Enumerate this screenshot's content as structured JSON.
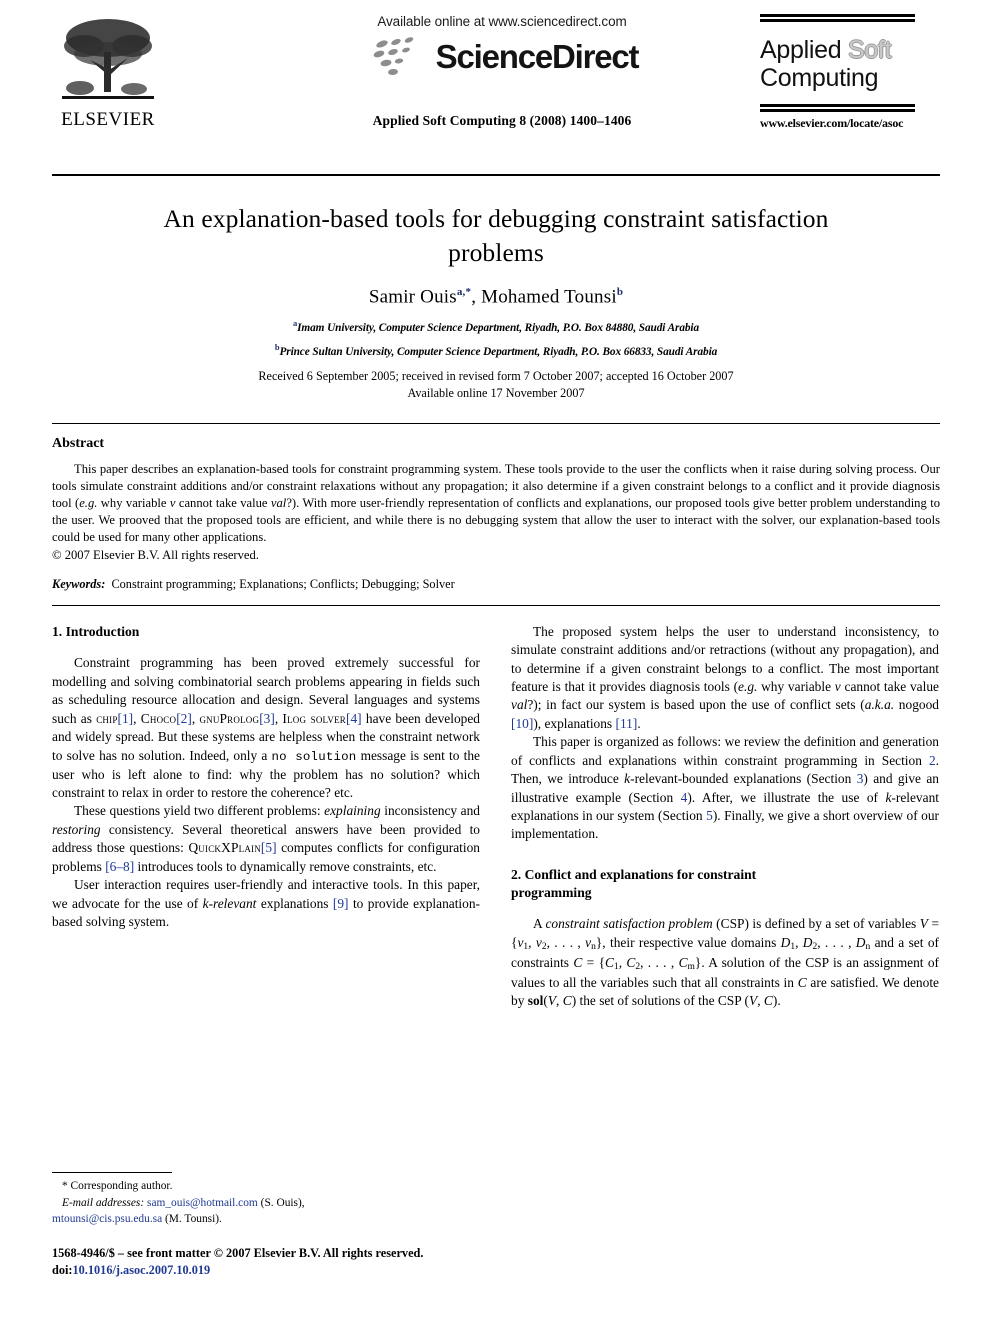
{
  "masthead": {
    "publisher_name": "ELSEVIER",
    "available_online": "Available online at www.sciencedirect.com",
    "sciencedirect_wordmark": "ScienceDirect",
    "journal_citation": "Applied Soft Computing 8 (2008) 1400–1406",
    "journal_logo_line1_a": "Applied ",
    "journal_logo_line1_b": "Soft",
    "journal_logo_line2": "Computing",
    "journal_url": "www.elsevier.com/locate/asoc"
  },
  "title": "An explanation-based tools for debugging constraint satisfaction problems",
  "authors": {
    "author1_name": "Samir Ouis",
    "author1_sup": "a,*",
    "separator": ", ",
    "author2_name": "Mohamed Tounsi",
    "author2_sup": "b"
  },
  "affiliations": [
    {
      "marker": "a",
      "text": "Imam University, Computer Science Department, Riyadh, P.O. Box 84880, Saudi Arabia"
    },
    {
      "marker": "b",
      "text": "Prince Sultan University, Computer Science Department, Riyadh, P.O. Box 66833, Saudi Arabia"
    }
  ],
  "history": {
    "line1": "Received 6 September 2005; received in revised form 7 October 2007; accepted 16 October 2007",
    "line2": "Available online 17 November 2007"
  },
  "abstract": {
    "heading": "Abstract",
    "p1_part1": "This paper describes an explanation-based tools for constraint programming system. These tools provide to the user the conflicts when it raise during solving process. Our tools simulate constraint additions and/or constraint relaxations without any propagation; it also determine if a given constraint belongs to a conflict and it provide diagnosis tool (",
    "p1_eg": "e.g.",
    "p1_part2": " why variable ",
    "p1_v": "v",
    "p1_part3": " cannot take value ",
    "p1_val": "val",
    "p1_part4": "?). With more user-friendly representation of conflicts and explanations, our proposed tools give better problem understanding to the user. We prooved that the proposed tools are efficient, and while there is no debugging system that allow the user to interact with the solver, our explanation-based tools could be used for many other applications.",
    "copyright": "© 2007 Elsevier B.V. All rights reserved.",
    "keywords_label": "Keywords:",
    "keywords_value": "Constraint programming; Explanations; Conflicts; Debugging; Solver"
  },
  "sections": {
    "intro_heading": "1. Introduction",
    "conflict_heading_line1": "2. Conflict and explanations for constraint",
    "conflict_heading_line2": "programming"
  },
  "left_column": {
    "p1_a": "Constraint programming has been proved extremely successful for modelling and solving combinatorial search problems appearing in fields such as scheduling resource allocation and design. Several languages and systems such as ",
    "p1_chip": "chip",
    "p1_c1": "[1]",
    "p1_b": ", ",
    "p1_choco": "Choco",
    "p1_c2": "[2]",
    "p1_c": ", ",
    "p1_gnuprolog": "gnuProlog",
    "p1_c3": "[3]",
    "p1_d": ", ",
    "p1_ilog": "Ilog solver",
    "p1_c4": "[4]",
    "p1_e": " have been developed and widely spread. But these systems are helpless when the constraint network to solve has no solution. Indeed, only a ",
    "p1_nosol": "no solution",
    "p1_f": " message is sent to the user who is left alone to find: why the problem has no solution? which constraint to relax in order to restore the coherence? etc.",
    "p2_a": "These questions yield two different problems: ",
    "p2_explaining": "explaining",
    "p2_b": " inconsistency and ",
    "p2_restoring": "restoring",
    "p2_c": " consistency. Several theoretical answers have been provided to address those questions: ",
    "p2_quickxplain": "QuickXPlain",
    "p2_c5": "[5]",
    "p2_d": " computes conflicts for configuration problems ",
    "p2_c68": "[6–8]",
    "p2_e": " introduces tools to dynamically remove constraints, etc.",
    "p3_a": "User interaction requires user-friendly and interactive tools. In this paper, we advocate for the use of ",
    "p3_krelevant": "k-relevant",
    "p3_b": " explanations ",
    "p3_c9": "[9]",
    "p3_c": " to provide explanation-based solving system."
  },
  "right_column": {
    "p1_a": "The proposed system helps the user to understand inconsistency, to simulate constraint additions and/or retractions (without any propagation), and to determine if a given constraint belongs to a conflict. The most important feature is that it provides diagnosis tools (",
    "p1_eg": "e.g.",
    "p1_b": " why variable ",
    "p1_v": "v",
    "p1_c": " cannot take value ",
    "p1_val": "val",
    "p1_d": "?); in fact our system is based upon the use of conflict sets (",
    "p1_aka": "a.k.a.",
    "p1_e": " nogood ",
    "p1_c10": "[10]",
    "p1_f": "), explanations ",
    "p1_c11": "[11]",
    "p1_g": ".",
    "p2_a": "This paper is organized as follows: we review the definition and generation of conflicts and explanations within constraint programming in Section ",
    "p2_s2": "2",
    "p2_b": ". Then, we introduce ",
    "p2_k1": "k",
    "p2_c": "-relevant-bounded explanations (Section ",
    "p2_s3": "3",
    "p2_d": ") and give an illustrative example (Section ",
    "p2_s4": "4",
    "p2_e": "). After, we illustrate the use of ",
    "p2_k2": "k",
    "p2_f": "-relevant explanations in our system (Section ",
    "p2_s5": "5",
    "p2_g": "). Finally, we give a short overview of our implementation.",
    "p3_a": "A ",
    "p3_csp_it": "constraint satisfaction problem",
    "p3_b": " (CSP) is defined by a set of variables ",
    "p3_V": "V",
    "p3_eq1": " = {",
    "p3_v1": "v",
    "p3_v1s": "1",
    "p3_v2": ", v",
    "p3_v2s": "2",
    "p3_dots": ", . . . , ",
    "p3_vn": "v",
    "p3_vns": "n",
    "p3_close1": "}",
    "p3_c": ", their respective value domains ",
    "p3_D1": "D",
    "p3_D1s": "1",
    "p3_D2": ", D",
    "p3_D2s": "2",
    "p3_Ddots": ", . . . , ",
    "p3_Dn": "D",
    "p3_Dns": "n",
    "p3_d": " and a set of constraints ",
    "p3_C": "C",
    "p3_eq2": " = {",
    "p3_C1": "C",
    "p3_C1s": "1",
    "p3_C2": ", C",
    "p3_C2s": "2",
    "p3_Cdots": ", . . . , ",
    "p3_Cm": "C",
    "p3_Cms": "m",
    "p3_close2": "}",
    "p3_e": ". A solution of the CSP is an assignment of values to all the variables such that all constraints in ",
    "p3_Cvar": "C",
    "p3_f": " are satisfied. We denote by ",
    "p3_sol": "sol",
    "p3_solargs_open": "(",
    "p3_solV": "V",
    "p3_solcomma": ", ",
    "p3_solC": "C",
    "p3_solargs_close": ")",
    "p3_g": " the set of solutions of the CSP ",
    "p3_VC_open": "(",
    "p3_VC_V": "V",
    "p3_VC_comma": ", ",
    "p3_VC_C": "C",
    "p3_VC_close": ")",
    "p3_h": "."
  },
  "footnote": {
    "star": "*",
    "corresponding": " Corresponding author.",
    "email_label": "E-mail addresses:",
    "email1": "sam_ouis@hotmail.com",
    "email1_owner": " (S. Ouis),",
    "email2": "mtounsi@cis.psu.edu.sa",
    "email2_owner": " (M. Tounsi)."
  },
  "publisher_footer": {
    "line1": "1568-4946/$ – see front matter © 2007 Elsevier B.V. All rights reserved.",
    "doi_label": "doi:",
    "doi_value": "10.1016/j.asoc.2007.10.019"
  }
}
